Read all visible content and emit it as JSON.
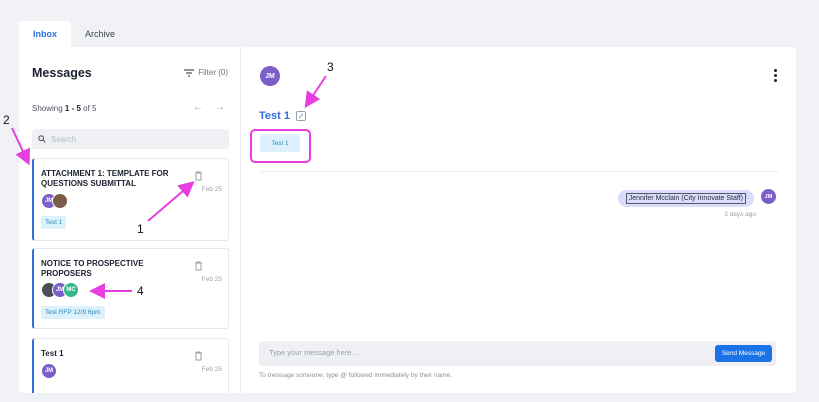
{
  "tabs": [
    {
      "label": "Inbox",
      "active": true
    },
    {
      "label": "Archive",
      "active": false
    }
  ],
  "sidebar": {
    "title": "Messages",
    "filter_label": "Filter (0)",
    "showing_prefix": "Showing ",
    "showing_range": "1 - 5",
    "showing_suffix": " of 5",
    "prev_icon": "arrow-left-icon",
    "next_icon": "arrow-right-icon",
    "search_placeholder": "Search",
    "items": [
      {
        "subject": "ATTACHMENT 1: TEMPLATE FOR QUESTIONS SUBMITTAL",
        "date": "Feb 25",
        "avatars": [
          "JM",
          ""
        ],
        "tag": "Test 1"
      },
      {
        "subject": "NOTICE TO PROSPECTIVE PROPOSERS",
        "date": "Feb 25",
        "avatars": [
          "",
          "JM",
          "MC"
        ],
        "tag": "Test RFP 12/9 6pm"
      },
      {
        "subject": "Test 1",
        "date": "Feb 25",
        "avatars": [
          "JM"
        ],
        "tag": ""
      }
    ]
  },
  "conversation": {
    "header_avatar": "JM",
    "title": "Test 1",
    "tag": "Test 1",
    "messages": [
      {
        "author": "Jennifer Mcclain (City Innovate Staff)",
        "avatar": "JM",
        "time": "3 days ago"
      }
    ],
    "compose_placeholder": "Type your message here ...",
    "send_label": "Send Message",
    "hint": "To message someone, type @ followed immediately by their name."
  },
  "annotations": [
    "1",
    "2",
    "3",
    "4"
  ],
  "colors": {
    "accent": "#2f6fdd",
    "annotation": "#e83de0",
    "avatar_jm": "#7b5ec7",
    "avatar_mc": "#35b889",
    "tag_bg": "#dcf1fb"
  }
}
